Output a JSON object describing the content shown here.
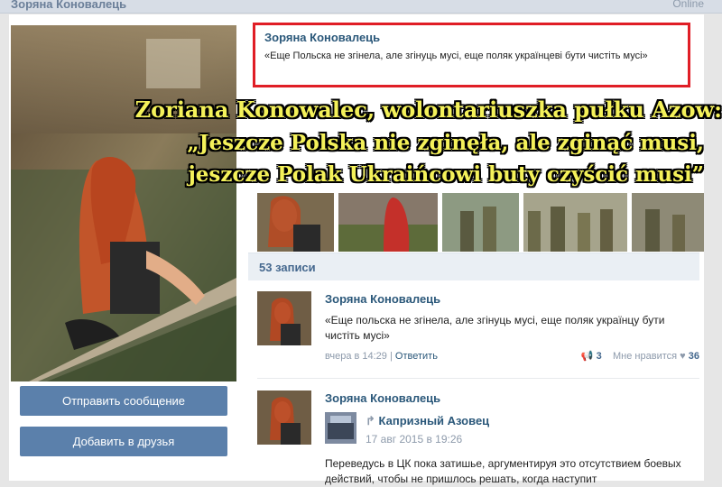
{
  "topbar": {
    "name": "Зоряна Коновалець",
    "online": "Online"
  },
  "profile": {
    "name": "Зоряна Коновалець",
    "status": "«Еще Польска не згінела, але згінуць мусі, еще поляк українцеві бути чистіть мусі»"
  },
  "buttons": {
    "send_message": "Отправить сообщение",
    "add_friend": "Добавить в друзья"
  },
  "overlay": {
    "line1": "Zoriana Konowalec, wolontariuszka pułku Azow:",
    "line2": "„Jeszcze Polska nie zginęła, ale zginąć musi,",
    "line3": "jeszcze Polak Ukraińcowi buty czyścić musi”"
  },
  "wall": {
    "count_label": "53 записи"
  },
  "posts": [
    {
      "author": "Зоряна Коновалець",
      "text": "«Еще польска не згінела, але згінуць мусі, еще поляк українцу бути чистіть мусі»",
      "time": "вчера в 14:29",
      "reply": "Ответить",
      "shares": "3",
      "like_label": "Мне нравится",
      "likes": "36"
    },
    {
      "author": "Зоряна Коновалець",
      "repost_author": "Капризный Азовец",
      "repost_time": "17 авг 2015 в 19:26",
      "text": "Переведусь в ЦК пока затишье, аргументируя это отсутствием боевых действий, чтобы не пришлось решать, когда наступит"
    }
  ],
  "colors": {
    "accent": "#5b80ab",
    "link": "#2b587a",
    "highlight": "#e01e26",
    "overlay_text": "#f4f15a"
  }
}
